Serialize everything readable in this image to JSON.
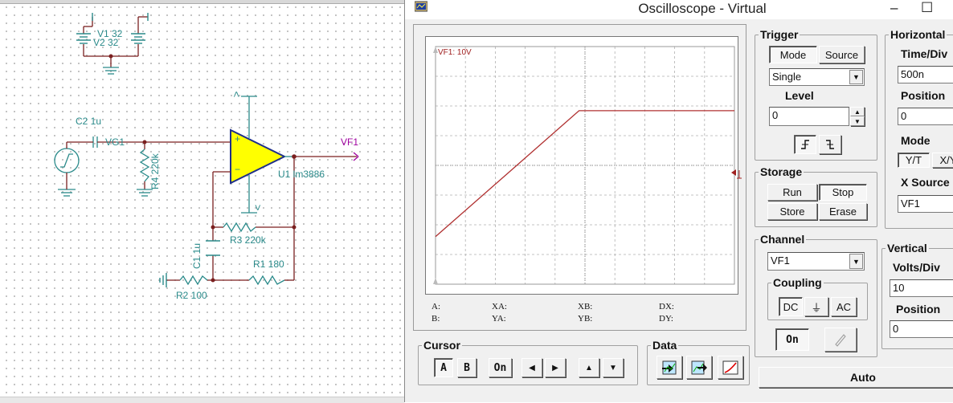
{
  "window": {
    "title": "Oscilloscope - Virtual",
    "minimize": "–",
    "maximize": "☐"
  },
  "schematic": {
    "labels": {
      "v1": "V1 32",
      "v2": "V2 32",
      "c2": "C2 1u",
      "vg1": "VG1",
      "r4": "R4 220k",
      "u1": "U1 lm3886",
      "vf1": "VF1",
      "r3": "R3 220k",
      "c1": "C1 1u",
      "r1": "R1 180",
      "r2": "R2 100",
      "vplus": ">",
      "vminus": ">",
      "plus": "+",
      "minus": "−"
    },
    "colors": {
      "wire": "#7a1f1f",
      "component": "#2a8a8a",
      "opamp_fill": "#ffff00",
      "node": "#7a1f1f",
      "probe": "#a000a0"
    }
  },
  "scope": {
    "channel_label": "VF1: 10V",
    "trace_color": "#b03030",
    "trace_points": [
      [
        0,
        0.2
      ],
      [
        0.48,
        0.73
      ],
      [
        1.0,
        0.73
      ]
    ],
    "readout": {
      "a": "A:",
      "b": "B:",
      "xa": "XA:",
      "ya": "YA:",
      "xb": "XB:",
      "yb": "YB:",
      "dx": "DX:",
      "dy": "DY:"
    }
  },
  "trigger": {
    "title": "Trigger",
    "mode_label": "Mode",
    "source_label": "Source",
    "mode_value": "Single",
    "level_label": "Level",
    "level_value": "0"
  },
  "storage": {
    "title": "Storage",
    "run": "Run",
    "stop": "Stop",
    "store": "Store",
    "erase": "Erase"
  },
  "channel": {
    "title": "Channel",
    "value": "VF1",
    "coupling_title": "Coupling",
    "dc": "DC",
    "gnd": "⏚",
    "ac": "AC",
    "on": "On"
  },
  "horizontal": {
    "title": "Horizontal",
    "timediv_label": "Time/Div",
    "timediv_value": "500n",
    "position_label": "Position",
    "position_value": "0",
    "mode_label": "Mode",
    "mode_yt": "Y/T",
    "mode_xy": "X/Y",
    "xsource_label": "X Source",
    "xsource_value": "VF1"
  },
  "vertical": {
    "title": "Vertical",
    "voltsdiv_label": "Volts/Div",
    "voltsdiv_value": "10",
    "position_label": "Position",
    "position_value": "0"
  },
  "cursor": {
    "title": "Cursor",
    "a": "A",
    "b": "B",
    "on": "On",
    "left": "◀",
    "right": "▶",
    "up": "▲",
    "down": "▼"
  },
  "data": {
    "title": "Data"
  },
  "auto": {
    "label": "Auto"
  }
}
